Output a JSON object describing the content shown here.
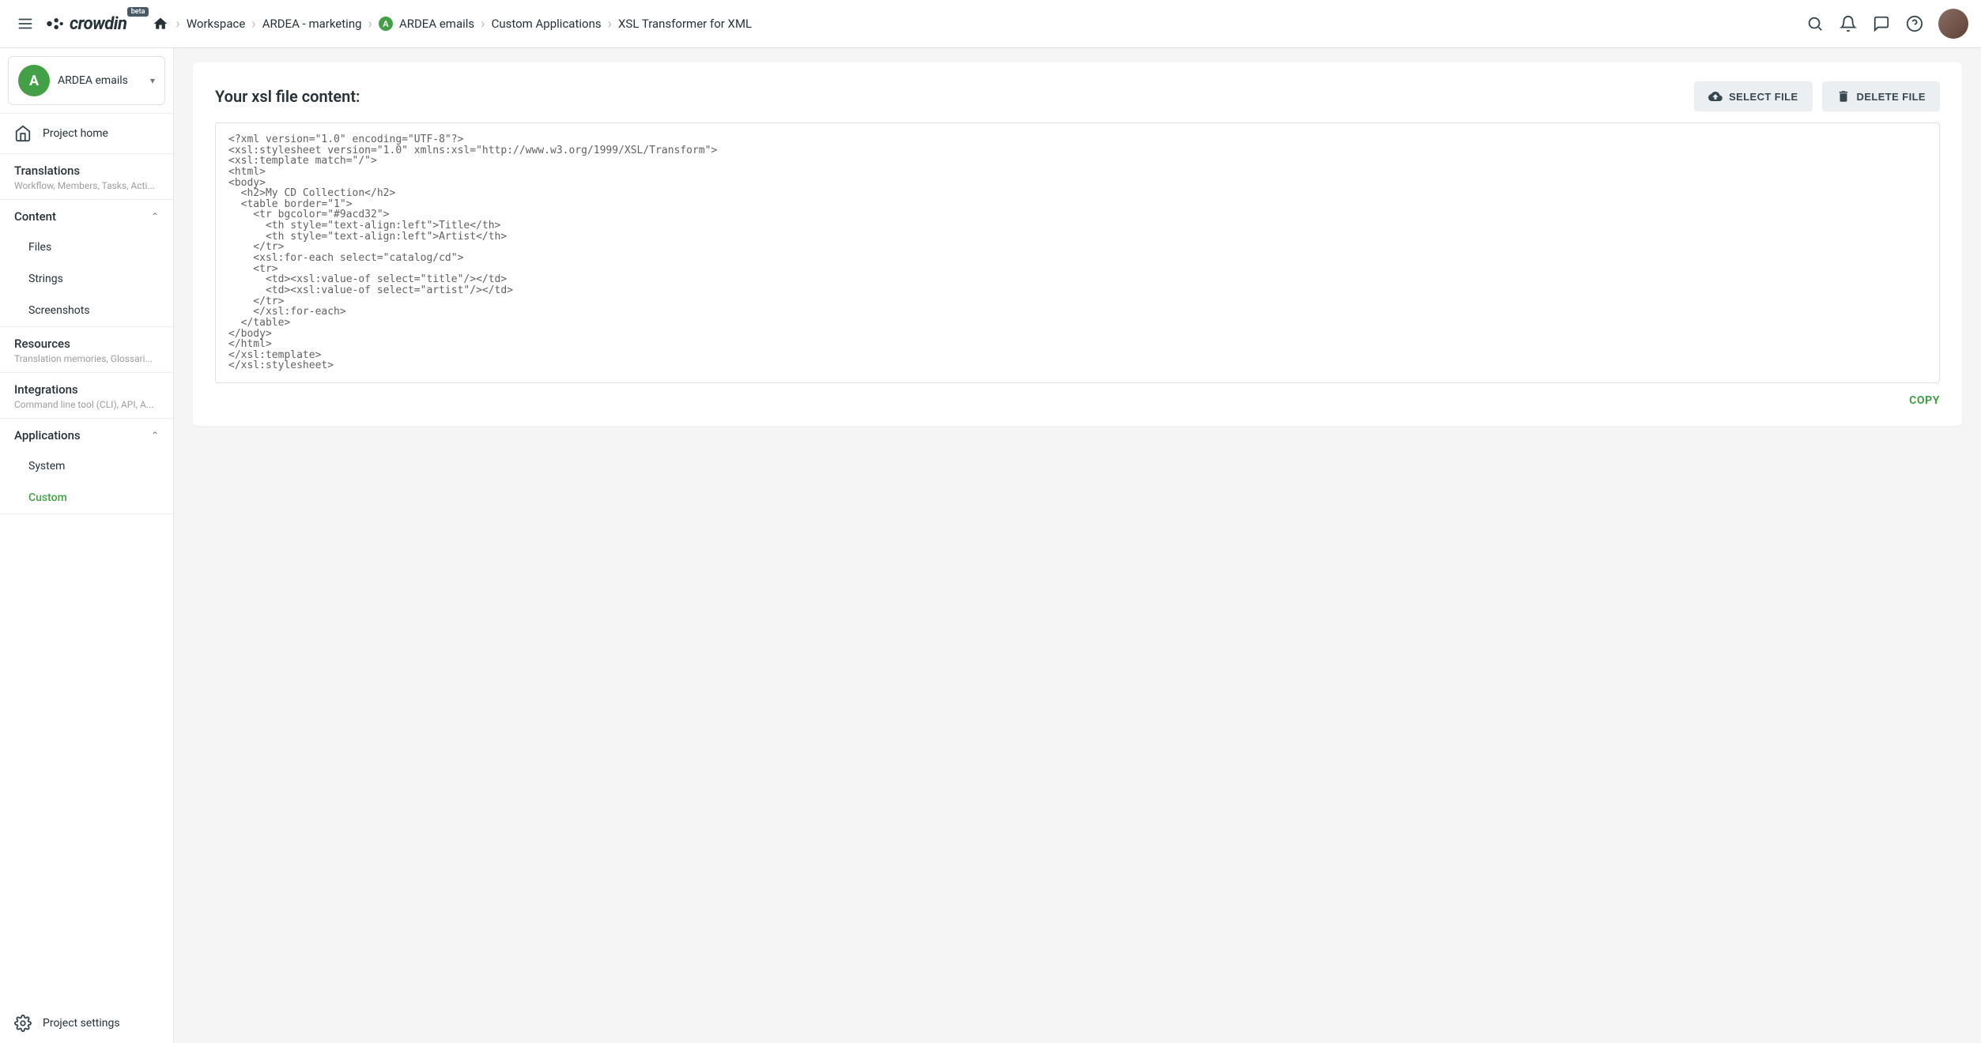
{
  "brand": {
    "name": "crowdin",
    "badge": "beta"
  },
  "breadcrumb": {
    "items": [
      {
        "label": "Workspace"
      },
      {
        "label": "ARDEA - marketing"
      },
      {
        "label": "ARDEA emails",
        "badge": "A"
      },
      {
        "label": "Custom Applications"
      }
    ],
    "current": "XSL Transformer for XML"
  },
  "sidebar": {
    "project": {
      "initial": "A",
      "name": "ARDEA emails"
    },
    "home": {
      "label": "Project home"
    },
    "translations": {
      "title": "Translations",
      "sub": "Workflow, Members, Tasks, Acti..."
    },
    "content": {
      "title": "Content",
      "children": [
        {
          "label": "Files"
        },
        {
          "label": "Strings"
        },
        {
          "label": "Screenshots"
        }
      ]
    },
    "resources": {
      "title": "Resources",
      "sub": "Translation memories, Glossari..."
    },
    "integrations": {
      "title": "Integrations",
      "sub": "Command line tool (CLI), API, A..."
    },
    "applications": {
      "title": "Applications",
      "children": [
        {
          "label": "System"
        },
        {
          "label": "Custom",
          "active": true
        }
      ]
    },
    "settings": {
      "label": "Project settings"
    }
  },
  "main": {
    "title": "Your xsl file content:",
    "select_btn": "SELECT FILE",
    "delete_btn": "DELETE FILE",
    "copy_btn": "COPY",
    "code": "<?xml version=\"1.0\" encoding=\"UTF-8\"?>\n<xsl:stylesheet version=\"1.0\" xmlns:xsl=\"http://www.w3.org/1999/XSL/Transform\">\n<xsl:template match=\"/\">\n<html>\n<body>\n  <h2>My CD Collection</h2>\n  <table border=\"1\">\n    <tr bgcolor=\"#9acd32\">\n      <th style=\"text-align:left\">Title</th>\n      <th style=\"text-align:left\">Artist</th>\n    </tr>\n    <xsl:for-each select=\"catalog/cd\">\n    <tr>\n      <td><xsl:value-of select=\"title\"/></td>\n      <td><xsl:value-of select=\"artist\"/></td>\n    </tr>\n    </xsl:for-each>\n  </table>\n</body>\n</html>\n</xsl:template>\n</xsl:stylesheet>"
  }
}
